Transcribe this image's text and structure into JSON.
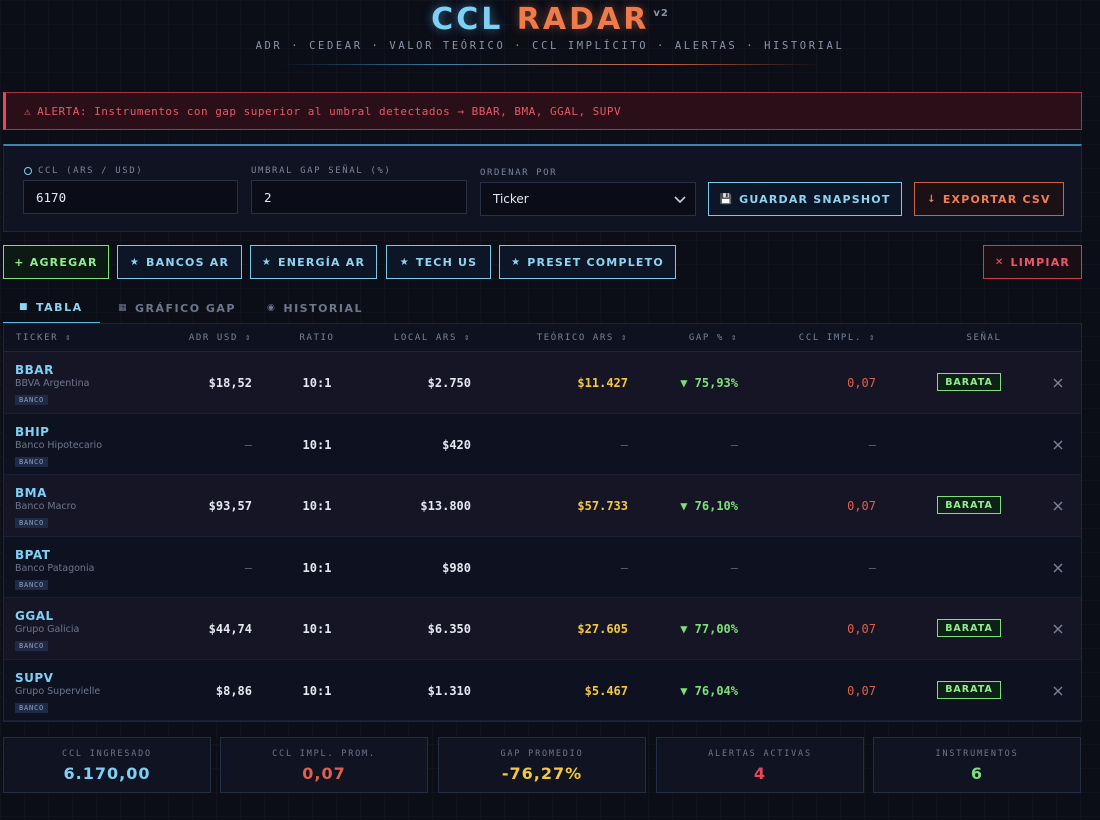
{
  "app": {
    "title_part1": "CCL",
    "title_part2": "RADAR",
    "version": "v2",
    "nav": [
      "ADR",
      "CEDEAR",
      "VALOR TEÓRICO",
      "CCL IMPLÍCITO",
      "ALERTAS",
      "HISTORIAL"
    ],
    "nav_text": "ADR · CEDEAR · VALOR TEÓRICO · CCL IMPLÍCITO · ALERTAS · HISTORIAL"
  },
  "alert": {
    "icon": "warning-icon",
    "text": "ALERTA: Instrumentos con gap superior al umbral detectados → BBAR, BMA, GGAL, SUPV"
  },
  "controls": {
    "ccl_label": "CCL (ARS / USD)",
    "ccl_value": "6170",
    "umbral_label": "UMBRAL GAP SEÑAL (%)",
    "umbral_value": "2",
    "ordenar_label": "ORDENAR POR",
    "ordenar_value": "Ticker",
    "save_label": "GUARDAR SNAPSHOT",
    "export_label": "EXPORTAR CSV"
  },
  "presets": {
    "add_label": "+ AGREGAR",
    "bancos_label": "BANCOS AR",
    "energia_label": "ENERGÍA AR",
    "tech_label": "TECH US",
    "completo_label": "PRESET COMPLETO",
    "clear_label": "LIMPIAR"
  },
  "tabs": [
    {
      "label": "TABLA",
      "active": true,
      "icon": "table-icon"
    },
    {
      "label": "GRÁFICO GAP",
      "active": false,
      "icon": "chart-icon"
    },
    {
      "label": "HISTORIAL",
      "active": false,
      "icon": "history-icon"
    }
  ],
  "table": {
    "headers": {
      "ticker": "TICKER ⇕",
      "adr": "ADR USD ⇕",
      "ratio": "RATIO",
      "local": "LOCAL ARS ⇕",
      "teorico": "TEÓRICO ARS ⇕",
      "gap": "GAP % ⇕",
      "ccl": "CCL IMPL. ⇕",
      "senal": "SEÑAL"
    },
    "rows": [
      {
        "ticker": "BBAR",
        "company": "BBVA Argentina",
        "tag": "BANCO",
        "adr": "$18,52",
        "ratio": "10:1",
        "local": "$2.750",
        "teorico": "$11.427",
        "gap": "▼ 75,93%",
        "ccl": "0,07",
        "signal": "BARATA"
      },
      {
        "ticker": "BHIP",
        "company": "Banco Hipotecario",
        "tag": "BANCO",
        "adr": "—",
        "ratio": "10:1",
        "local": "$420",
        "teorico": "—",
        "gap": "—",
        "ccl": "—",
        "signal": ""
      },
      {
        "ticker": "BMA",
        "company": "Banco Macro",
        "tag": "BANCO",
        "adr": "$93,57",
        "ratio": "10:1",
        "local": "$13.800",
        "teorico": "$57.733",
        "gap": "▼ 76,10%",
        "ccl": "0,07",
        "signal": "BARATA"
      },
      {
        "ticker": "BPAT",
        "company": "Banco Patagonia",
        "tag": "BANCO",
        "adr": "—",
        "ratio": "10:1",
        "local": "$980",
        "teorico": "—",
        "gap": "—",
        "ccl": "—",
        "signal": ""
      },
      {
        "ticker": "GGAL",
        "company": "Grupo Galicia",
        "tag": "BANCO",
        "adr": "$44,74",
        "ratio": "10:1",
        "local": "$6.350",
        "teorico": "$27.605",
        "gap": "▼ 77,00%",
        "ccl": "0,07",
        "signal": "BARATA"
      },
      {
        "ticker": "SUPV",
        "company": "Grupo Supervielle",
        "tag": "BANCO",
        "adr": "$8,86",
        "ratio": "10:1",
        "local": "$1.310",
        "teorico": "$5.467",
        "gap": "▼ 76,04%",
        "ccl": "0,07",
        "signal": "BARATA"
      }
    ]
  },
  "stats": [
    {
      "label": "CCL INGRESADO",
      "value": "6.170,00",
      "color": "#7fd0f5"
    },
    {
      "label": "CCL IMPL. PROM.",
      "value": "0,07",
      "color": "#e0604a"
    },
    {
      "label": "GAP PROMEDIO",
      "value": "-76,27%",
      "color": "#f5c842"
    },
    {
      "label": "ALERTAS ACTIVAS",
      "value": "4",
      "color": "#e8485a"
    },
    {
      "label": "INSTRUMENTOS",
      "value": "6",
      "color": "#7ee07a"
    }
  ],
  "colors": {
    "accent_blue": "#7fd0f5",
    "accent_orange": "#f07a4a",
    "positive_green": "#7ee07a",
    "alert_red": "#e8485a",
    "highlight_yellow": "#f5c842"
  }
}
